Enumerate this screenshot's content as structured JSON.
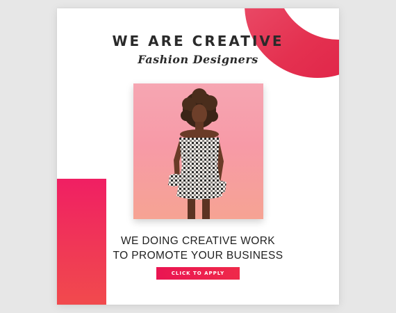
{
  "card": {
    "title": "WE ARE CREATIVE",
    "subtitle": "Fashion Designers",
    "headline_line1": "WE DOING CREATIVE WORK",
    "headline_line2": "TO PROMOTE YOUR BUSINESS",
    "cta_label": "CLICK TO APPLY"
  },
  "colors": {
    "accent": "#ef1f5a",
    "photo_background": "#f79aa7",
    "text": "#2a2a2a"
  }
}
